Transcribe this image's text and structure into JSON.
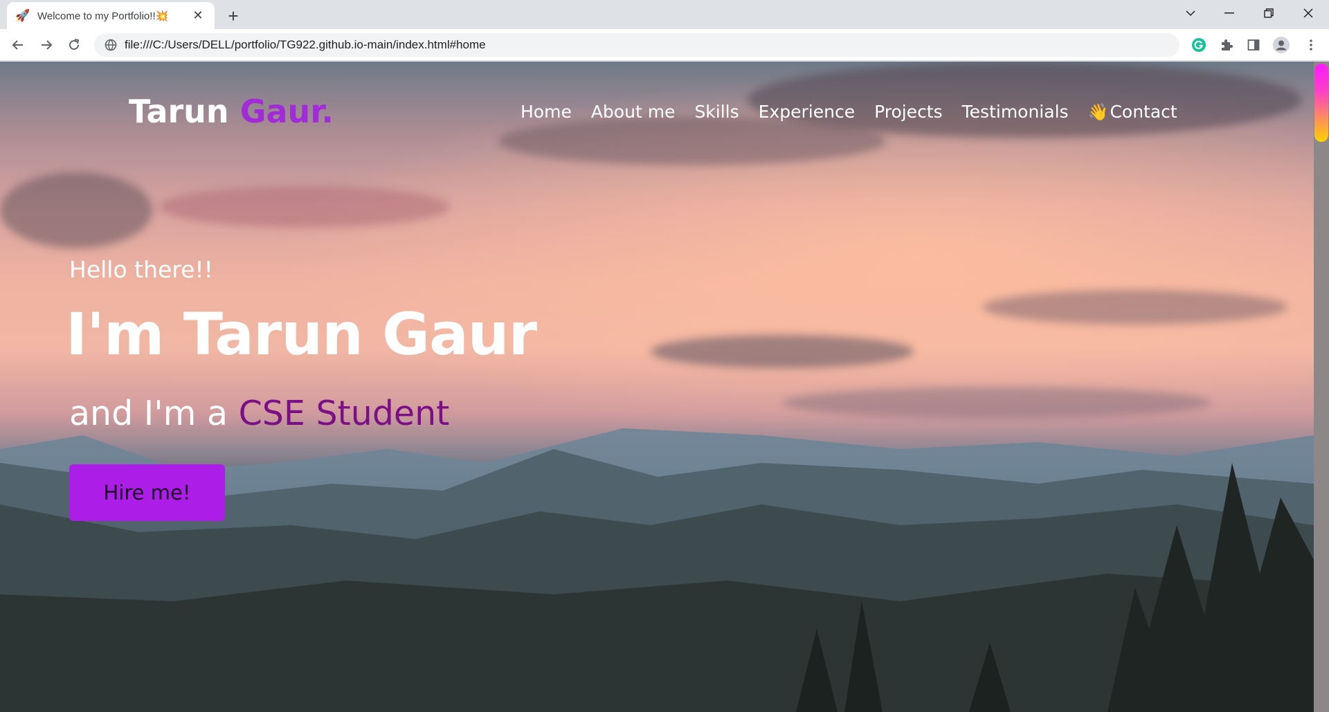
{
  "browser": {
    "tab": {
      "title": "Welcome to my Portfolio!!",
      "favicon": "rocket-icon",
      "title_emoji": "sparkle-icon"
    },
    "address_bar": {
      "url": "file:///C:/Users/DELL/portfolio/TG922.github.io-main/index.html#home"
    },
    "extensions": [
      "grammarly-icon",
      "puzzle-icon",
      "side-panel-icon",
      "profile-icon",
      "menu-icon"
    ],
    "colors": {
      "tabstrip": "#dee1e6",
      "toolbar": "#ffffff",
      "omnibox": "#f1f3f4"
    }
  },
  "site": {
    "logo": {
      "first": "Tarun ",
      "accent": "Gaur."
    },
    "menu": {
      "home": "Home",
      "about": "About me",
      "skills": "Skills",
      "experience": "Experience",
      "projects": "Projects",
      "testimonials": "Testimonials",
      "contact": "Contact"
    },
    "hero": {
      "greeting": "Hello there!!",
      "name": "I'm Tarun Gaur",
      "role_prefix": "and I'm a ",
      "role": "CSE Student",
      "cta": "Hire me!"
    },
    "colors": {
      "accent": "#a22bd9",
      "role_text": "#7b0f86",
      "cta_bg": "#ad1de8"
    }
  }
}
